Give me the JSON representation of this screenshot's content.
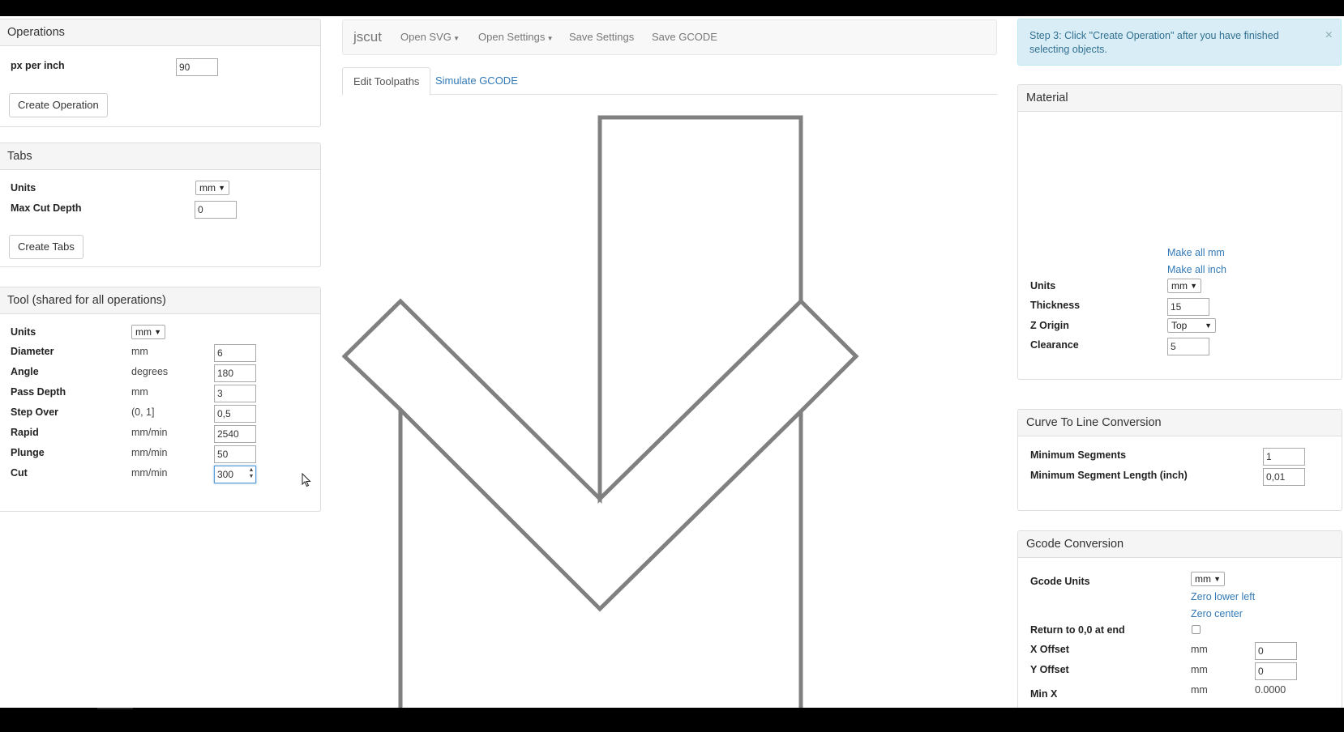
{
  "operations": {
    "title": "Operations",
    "px_per_inch_label": "px per inch",
    "px_per_inch_value": "90",
    "create_button": "Create Operation"
  },
  "tabs_panel": {
    "title": "Tabs",
    "units_label": "Units",
    "units_value": "mm",
    "max_cut_depth_label": "Max Cut Depth",
    "max_cut_depth_value": "0",
    "create_button": "Create Tabs"
  },
  "tool": {
    "title": "Tool (shared for all operations)",
    "units_label": "Units",
    "units_value": "mm",
    "rows": [
      {
        "label": "Diameter",
        "unit": "mm",
        "value": "6"
      },
      {
        "label": "Angle",
        "unit": "degrees",
        "value": "180"
      },
      {
        "label": "Pass Depth",
        "unit": "mm",
        "value": "3"
      },
      {
        "label": "Step Over",
        "unit": "(0, 1]",
        "value": "0,5"
      },
      {
        "label": "Rapid",
        "unit": "mm/min",
        "value": "2540"
      },
      {
        "label": "Plunge",
        "unit": "mm/min",
        "value": "50"
      },
      {
        "label": "Cut",
        "unit": "mm/min",
        "value": "300"
      }
    ]
  },
  "navbar": {
    "brand": "jscut",
    "open_svg": "Open SVG",
    "open_settings": "Open Settings",
    "save_settings": "Save Settings",
    "save_gcode": "Save GCODE"
  },
  "view_tabs": {
    "edit": "Edit Toolpaths",
    "simulate": "Simulate GCODE"
  },
  "alert": {
    "text": "Step 3: Click \"Create Operation\" after you have finished selecting objects.",
    "close": "×"
  },
  "material": {
    "title": "Material",
    "make_all_mm": "Make all mm",
    "make_all_inch": "Make all inch",
    "units_label": "Units",
    "units_value": "mm",
    "thickness_label": "Thickness",
    "thickness_value": "15",
    "z_origin_label": "Z Origin",
    "z_origin_value": "Top",
    "clearance_label": "Clearance",
    "clearance_value": "5"
  },
  "curve": {
    "title": "Curve To Line Conversion",
    "min_segments_label": "Minimum Segments",
    "min_segments_value": "1",
    "min_seg_length_label": "Minimum Segment Length (inch)",
    "min_seg_length_value": "0,01"
  },
  "gcode": {
    "title": "Gcode Conversion",
    "units_label": "Gcode Units",
    "units_value": "mm",
    "zero_lower_left": "Zero lower left",
    "zero_center": "Zero center",
    "return_label": "Return to 0,0 at end",
    "x_offset_label": "X Offset",
    "x_offset_unit": "mm",
    "x_offset_value": "0",
    "y_offset_label": "Y Offset",
    "y_offset_unit": "mm",
    "y_offset_value": "0",
    "min_x_label": "Min X",
    "min_x_unit": "mm",
    "min_x_value": "0.0000"
  },
  "icons": {
    "caret": "caret-down-icon",
    "close": "close-icon",
    "cursor": "mouse-cursor-icon"
  }
}
